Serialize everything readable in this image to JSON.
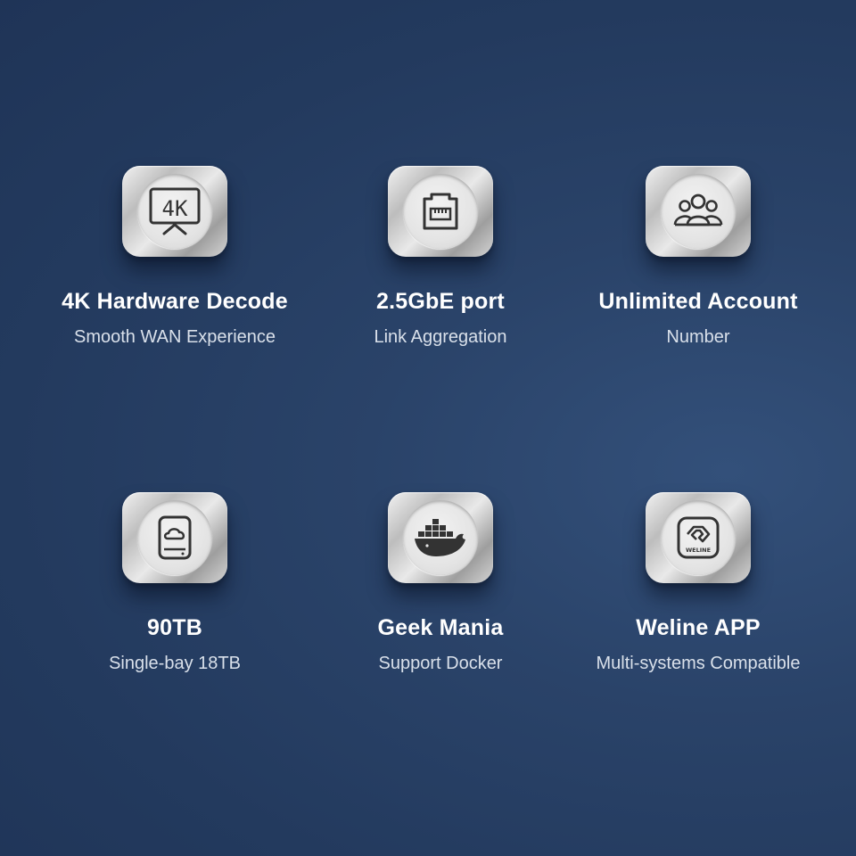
{
  "features": [
    {
      "title": "4K Hardware Decode",
      "subtitle": "Smooth WAN Experience",
      "icon": "4k-tv-icon",
      "icon_text": "4K"
    },
    {
      "title": "2.5GbE port",
      "subtitle": "Link Aggregation",
      "icon": "ethernet-port-icon"
    },
    {
      "title": "Unlimited Account",
      "subtitle": "Number",
      "icon": "users-group-icon"
    },
    {
      "title": "90TB",
      "subtitle": "Single-bay 18TB",
      "icon": "cloud-drive-icon"
    },
    {
      "title": "Geek Mania",
      "subtitle": "Support Docker",
      "icon": "docker-whale-icon"
    },
    {
      "title": "Weline APP",
      "subtitle": "Multi-systems Compatible",
      "icon": "weline-logo-icon",
      "icon_text": "WELINE"
    }
  ],
  "colors": {
    "background": "#253d62",
    "title": "#ffffff",
    "subtitle": "#d9e0ea",
    "icon_stroke": "#333333"
  }
}
